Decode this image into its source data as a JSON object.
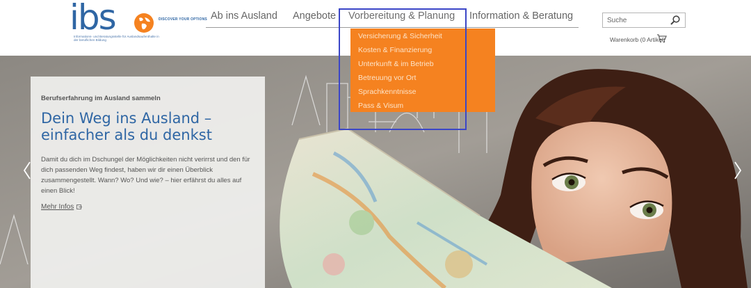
{
  "brand": {
    "logo_text": "ibs",
    "claim": "DISCOVER YOUR OPTIONS",
    "subline": "Informations- und Beratungsstelle für Auslandsaufenthalte in der beruflichen Bildung",
    "primary_color": "#2f66a4",
    "accent_color": "#f58220"
  },
  "nav": {
    "items": [
      {
        "label": "Ab ins Ausland"
      },
      {
        "label": "Angebote"
      },
      {
        "label": "Vorbereitung & Planung",
        "active": true
      },
      {
        "label": "Information & Beratung"
      }
    ],
    "dropdown": [
      {
        "label": "Versicherung & Sicherheit"
      },
      {
        "label": "Kosten & Finanzierung"
      },
      {
        "label": "Unterkunft & im Betrieb"
      },
      {
        "label": "Betreuung vor Ort"
      },
      {
        "label": "Sprachkenntnisse"
      },
      {
        "label": "Pass & Visum"
      }
    ]
  },
  "search": {
    "placeholder": "Suche",
    "icon": "search-icon"
  },
  "cart": {
    "label": "Warenkorb (0 Artikel)",
    "icon": "cart-icon"
  },
  "teaser": {
    "kicker": "Berufserfahrung im Ausland sammeln",
    "title": "Dein Weg ins Ausland – einfacher als du denkst",
    "text": "Damit du dich im Dschungel der Möglichkeiten nicht verirrst und den für dich passenden Weg findest, haben wir dir einen Überblick zusammengestellt. Wann? Wo? Und wie? – hier erfährst du alles auf einen Blick!",
    "link_label": "Mehr Infos"
  },
  "carousel": {
    "prev_icon": "chevron-left-icon",
    "next_icon": "chevron-right-icon"
  }
}
